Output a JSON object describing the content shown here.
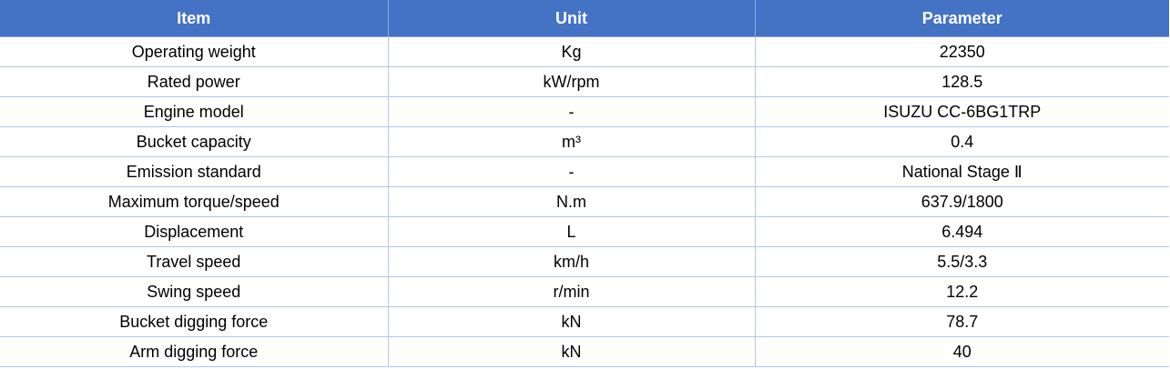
{
  "table": {
    "headers": [
      "Item",
      "Unit",
      "Parameter"
    ],
    "rows": [
      [
        "Operating weight",
        "Kg",
        "22350"
      ],
      [
        "Rated power",
        "kW/rpm",
        "128.5"
      ],
      [
        "Engine model",
        "-",
        "ISUZU CC-6BG1TRP"
      ],
      [
        "Bucket capacity",
        "m³",
        "0.4"
      ],
      [
        "Emission standard",
        "-",
        "National Stage Ⅱ"
      ],
      [
        "Maximum torque/speed",
        "N.m",
        "637.9/1800"
      ],
      [
        "Displacement",
        "L",
        "6.494"
      ],
      [
        "Travel speed",
        "km/h",
        "5.5/3.3"
      ],
      [
        "Swing speed",
        "r/min",
        "12.2"
      ],
      [
        "Bucket digging force",
        "kN",
        "78.7"
      ],
      [
        "Arm digging force",
        "kN",
        "40"
      ]
    ]
  },
  "colors": {
    "header_bg": "#4472c4",
    "header_text": "#ffffff",
    "grid_line": "#b4c6e7"
  }
}
